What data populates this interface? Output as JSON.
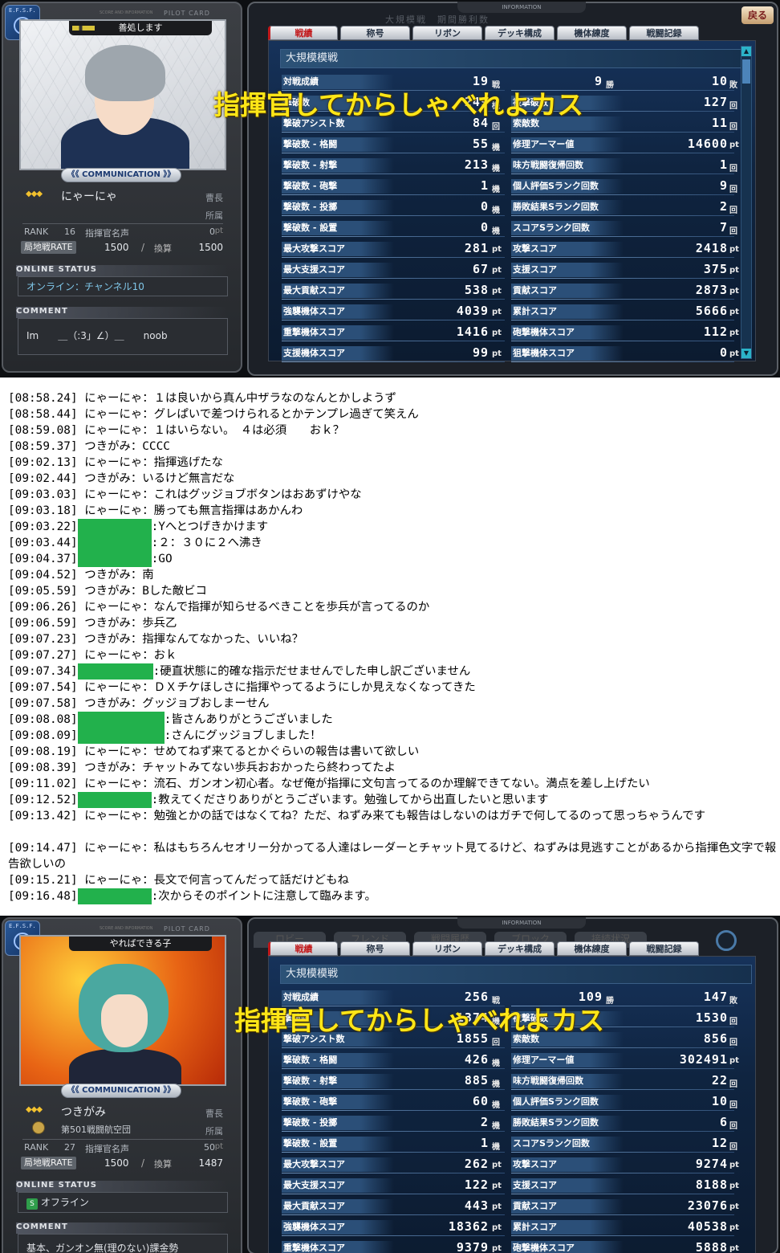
{
  "card_header": {
    "brand": "E.F.S.F.",
    "title": "PILOT CARD",
    "subtitle": "SCORE AND INFORMATION",
    "communication": "《《 COMMUNICATION 》》"
  },
  "info_header": {
    "title": "INFORMATION"
  },
  "online_status_label": "ONLINE STATUS",
  "comment_label": "COMMENT",
  "rate_label": "局地戦RATE",
  "rank_label": "RANK",
  "shikikan_label": "指揮官名声",
  "pt_unit": "pt",
  "calc_label": "換算",
  "shozoku_label": "所属",
  "overlay_text": "指揮官してからしゃべれよカス",
  "tabs": [
    "戦績",
    "称号",
    "リボン",
    "デッキ構成",
    "機体練度",
    "戦闘記録"
  ],
  "panel1": {
    "card_title": "善処します",
    "name": "にゃーにゃ",
    "rank_title": "曹長",
    "corps": "",
    "rank": "16",
    "shikikan": "0",
    "rate": "1500",
    "rate_calc": "1500",
    "online": "オンライン：チャンネル10",
    "comment": "Im　　＿（:3」∠）＿　　noob",
    "info_sub": "大規模戦　期間勝利数",
    "back": "戻る",
    "category": "大規模模戦",
    "rows": [
      {
        "l1": "対戦成績",
        "v1": "19",
        "u1": "戦",
        "mid": "9",
        "mu": "勝",
        "v2": "10",
        "u2": "敗"
      },
      {
        "l1": "撃破数",
        "v1": "249",
        "u1": "機",
        "l2": "被撃破数",
        "v2": "127",
        "u2": "回"
      },
      {
        "l1": "撃破アシスト数",
        "v1": "84",
        "u1": "回",
        "l2": "索敵数",
        "v2": "11",
        "u2": "回"
      },
      {
        "l1": "撃破数 - 格闘",
        "v1": "55",
        "u1": "機",
        "l2": "修理アーマー値",
        "v2": "14600",
        "u2": "pt"
      },
      {
        "l1": "撃破数 - 射撃",
        "v1": "213",
        "u1": "機",
        "l2": "味方戦闘復帰回数",
        "v2": "1",
        "u2": "回"
      },
      {
        "l1": "撃破数 - 砲撃",
        "v1": "1",
        "u1": "機",
        "l2": "個人評価Sランク回数",
        "v2": "9",
        "u2": "回"
      },
      {
        "l1": "撃破数 - 投擲",
        "v1": "0",
        "u1": "機",
        "l2": "勝敗結果Sランク回数",
        "v2": "2",
        "u2": "回"
      },
      {
        "l1": "撃破数 - 設置",
        "v1": "0",
        "u1": "機",
        "l2": "スコアSランク回数",
        "v2": "7",
        "u2": "回"
      },
      {
        "l1": "最大攻撃スコア",
        "v1": "281",
        "u1": "pt",
        "l2": "攻撃スコア",
        "v2": "2418",
        "u2": "pt"
      },
      {
        "l1": "最大支援スコア",
        "v1": "67",
        "u1": "pt",
        "l2": "支援スコア",
        "v2": "375",
        "u2": "pt"
      },
      {
        "l1": "最大貢献スコア",
        "v1": "538",
        "u1": "pt",
        "l2": "貢献スコア",
        "v2": "2873",
        "u2": "pt"
      },
      {
        "l1": "強襲機体スコア",
        "v1": "4039",
        "u1": "pt",
        "l2": "累計スコア",
        "v2": "5666",
        "u2": "pt"
      },
      {
        "l1": "重撃機体スコア",
        "v1": "1416",
        "u1": "pt",
        "l2": "砲撃機体スコア",
        "v2": "112",
        "u2": "pt"
      },
      {
        "l1": "支援機体スコア",
        "v1": "99",
        "u1": "pt",
        "l2": "狙撃機体スコア",
        "v2": "0",
        "u2": "pt"
      }
    ]
  },
  "panel2": {
    "card_title": "やればできる子",
    "name": "つきがみ",
    "rank_title": "曹長",
    "corps": "第501戦闘航空団",
    "rank": "27",
    "shikikan": "50",
    "rate": "1500",
    "rate_calc": "1487",
    "online_icon": "S",
    "online": "オフライン",
    "comment": "基本、ガンオン無(理のない)課金勢",
    "category": "大規模模戦",
    "ghost_tabs": [
      "ロビー",
      "フレンド",
      "戦闘履歴",
      "ブロック",
      "接続状況"
    ],
    "rows": [
      {
        "l1": "対戦成績",
        "v1": "256",
        "u1": "戦",
        "mid": "109",
        "mu": "勝",
        "v2": "147",
        "u2": "敗"
      },
      {
        "l1": "撃破数",
        "v1": "1374",
        "u1": "機",
        "l2": "被撃破数",
        "v2": "1530",
        "u2": "回"
      },
      {
        "l1": "撃破アシスト数",
        "v1": "1855",
        "u1": "回",
        "l2": "索敵数",
        "v2": "856",
        "u2": "回"
      },
      {
        "l1": "撃破数 - 格闘",
        "v1": "426",
        "u1": "機",
        "l2": "修理アーマー値",
        "v2": "302491",
        "u2": "pt"
      },
      {
        "l1": "撃破数 - 射撃",
        "v1": "885",
        "u1": "機",
        "l2": "味方戦闘復帰回数",
        "v2": "22",
        "u2": "回"
      },
      {
        "l1": "撃破数 - 砲撃",
        "v1": "60",
        "u1": "機",
        "l2": "個人評価Sランク回数",
        "v2": "10",
        "u2": "回"
      },
      {
        "l1": "撃破数 - 投擲",
        "v1": "2",
        "u1": "機",
        "l2": "勝敗結果Sランク回数",
        "v2": "6",
        "u2": "回"
      },
      {
        "l1": "撃破数 - 設置",
        "v1": "1",
        "u1": "機",
        "l2": "スコアSランク回数",
        "v2": "12",
        "u2": "回"
      },
      {
        "l1": "最大攻撃スコア",
        "v1": "262",
        "u1": "pt",
        "l2": "攻撃スコア",
        "v2": "9274",
        "u2": "pt"
      },
      {
        "l1": "最大支援スコア",
        "v1": "122",
        "u1": "pt",
        "l2": "支援スコア",
        "v2": "8188",
        "u2": "pt"
      },
      {
        "l1": "最大貢献スコア",
        "v1": "443",
        "u1": "pt",
        "l2": "貢献スコア",
        "v2": "23076",
        "u2": "pt"
      },
      {
        "l1": "強襲機体スコア",
        "v1": "18362",
        "u1": "pt",
        "l2": "累計スコア",
        "v2": "40538",
        "u2": "pt"
      },
      {
        "l1": "重撃機体スコア",
        "v1": "9379",
        "u1": "pt",
        "l2": "砲撃機体スコア",
        "v2": "5888",
        "u2": "pt"
      }
    ]
  },
  "chat": [
    {
      "t": "[08:58.24]",
      "s": "にゃーにゃ",
      "m": "１は良いから真ん中ザラなのなんとかしようず"
    },
    {
      "t": "[08:58.44]",
      "s": "にゃーにゃ",
      "m": "グレぱいで差つけられるとかテンプレ過ぎて笑えん"
    },
    {
      "t": "[08:59.08]",
      "s": "にゃーにゃ",
      "m": "１はいらない。　４は必須　　おｋ？"
    },
    {
      "t": "[08:59.37]",
      "s": "つきがみ",
      "m": "CCCC"
    },
    {
      "t": "[09:02.13]",
      "s": "にゃーにゃ",
      "m": "指揮逃げたな"
    },
    {
      "t": "[09:02.44]",
      "s": "つきがみ",
      "m": "いるけど無言だな"
    },
    {
      "t": "[09:03.03]",
      "s": "にゃーにゃ",
      "m": "これはグッジョブボタンはおあずけやな"
    },
    {
      "t": "[09:03.18]",
      "s": "にゃーにゃ",
      "m": "勝っても無言指揮はあかんわ"
    },
    {
      "t": "[09:03.22]",
      "mask": 92,
      "m": "Yへとつげきかけます"
    },
    {
      "t": "[09:03.44]",
      "mask": 92,
      "m": "２：３０に２へ沸き"
    },
    {
      "t": "[09:04.37]",
      "mask": 92,
      "m": "GO"
    },
    {
      "t": "[09:04.52]",
      "s": "つきがみ",
      "m": "南"
    },
    {
      "t": "[09:05.59]",
      "s": "つきがみ",
      "m": "Bした敵ビコ"
    },
    {
      "t": "[09:06.26]",
      "s": "にゃーにゃ",
      "m": "なんで指揮が知らせるべきことを歩兵が言ってるのか"
    },
    {
      "t": "[09:06.59]",
      "s": "つきがみ",
      "m": "歩兵乙"
    },
    {
      "t": "[09:07.23]",
      "s": "つきがみ",
      "m": "指揮なんてなかった、いいね？"
    },
    {
      "t": "[09:07.27]",
      "s": "にゃーにゃ",
      "m": "おｋ"
    },
    {
      "t": "[09:07.34]",
      "mask": 94,
      "m": "硬直状態に的確な指示だせませんでした申し訳ございません"
    },
    {
      "t": "[09:07.54]",
      "s": "にゃーにゃ",
      "m": "ＤＸチケほしさに指揮やってるようにしか見えなくなってきた"
    },
    {
      "t": "[09:07.58]",
      "s": "つきがみ",
      "m": "グッジョブおしまーせん"
    },
    {
      "t": "[09:08.08]",
      "mask": 108,
      "m": "皆さんありがとうございました"
    },
    {
      "t": "[09:08.09]",
      "mask": 108,
      "m": "さんにグッジョブしました！"
    },
    {
      "t": "[09:08.19]",
      "s": "にゃーにゃ",
      "m": "せめてねず来てるとかぐらいの報告は書いて欲しい"
    },
    {
      "t": "[09:08.39]",
      "s": "つきがみ",
      "m": "チャットみてない歩兵おおかったら終わってたよ"
    },
    {
      "t": "[09:11.02]",
      "s": "にゃーにゃ",
      "m": "流石、ガンオン初心者。なぜ俺が指揮に文句言ってるのか理解できてない。満点を差し上げたい"
    },
    {
      "t": "[09:12.52]",
      "mask": 92,
      "m": "教えてくださりありがとうございます。勉強してから出直したいと思います"
    },
    {
      "t": "[09:13.42]",
      "s": "にゃーにゃ",
      "m": "勉強とかの話ではなくてね？ただ、ねずみ来ても報告はしないのはガチで何してるのって思っちゃうんです",
      "wrap": true
    },
    {
      "t": "[09:14.47]",
      "s": "にゃーにゃ",
      "m": "私はもちろんセオリー分かってる人達はレーダーとチャット見てるけど、ねずみは見逃すことがあるから指揮色文字で報告欲しいの",
      "wrap": true
    },
    {
      "t": "[09:15.21]",
      "s": "にゃーにゃ",
      "m": "長文で何言ってんだって話だけどもね"
    },
    {
      "t": "[09:16.48]",
      "mask": 92,
      "m": "次からそのポイントに注意して臨みます。"
    }
  ]
}
